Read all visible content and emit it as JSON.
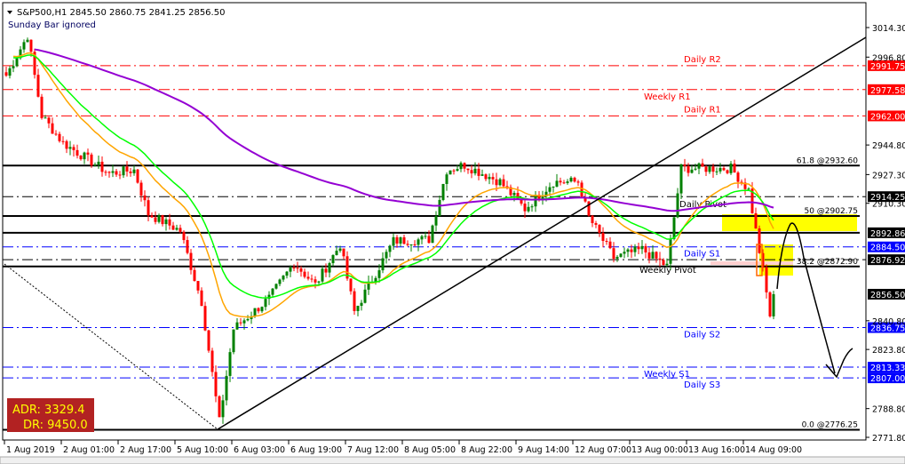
{
  "header": {
    "symbol_line": "S&P500,H1  2845.50 2860.75 2841.25 2856.50",
    "note": "Sunday Bar ignored"
  },
  "adr_box": {
    "adr": "ADR: 3329.4",
    "dr": "DR: 9450.0",
    "bg": "#b22222",
    "fg": "#ffff00"
  },
  "colors": {
    "bull": "#008000",
    "bear": "#ff0000",
    "ma_fast": "#ffa500",
    "ma_mid": "#00ff00",
    "ma_slow": "#9400d3",
    "ma_daily": "#006400"
  },
  "chart_data": {
    "type": "candlestick",
    "title": "S&P500,H1",
    "x_ticks": [
      "1 Aug 2019",
      "2 Aug 01:00",
      "2 Aug 17:00",
      "5 Aug 10:00",
      "6 Aug 03:00",
      "6 Aug 19:00",
      "7 Aug 12:00",
      "8 Aug 05:00",
      "8 Aug 22:00",
      "9 Aug 14:00",
      "12 Aug 07:00",
      "13 Aug 00:00",
      "13 Aug 16:00",
      "14 Aug 09:00"
    ],
    "bars_per_tick": 16,
    "y_ticks": [
      "3014.30",
      "2996.80",
      "2944.80",
      "2927.30",
      "2910.30",
      "2840.80",
      "2823.80",
      "2788.80",
      "2771.80"
    ],
    "ylim": [
      2771.8,
      3014.3
    ],
    "close_keyframes": [
      [
        0,
        2985.9
      ],
      [
        6,
        3009.6
      ],
      [
        10,
        2962
      ],
      [
        16,
        2946
      ],
      [
        29,
        2928
      ],
      [
        36,
        2930
      ],
      [
        40,
        2904
      ],
      [
        49,
        2894
      ],
      [
        55,
        2852
      ],
      [
        60,
        2781
      ],
      [
        64,
        2836
      ],
      [
        74,
        2854
      ],
      [
        81,
        2875
      ],
      [
        87,
        2862
      ],
      [
        94,
        2886
      ],
      [
        98,
        2846
      ],
      [
        109,
        2888
      ],
      [
        119,
        2889
      ],
      [
        124,
        2930
      ],
      [
        129,
        2933
      ],
      [
        139,
        2923
      ],
      [
        146,
        2907
      ],
      [
        154,
        2923
      ],
      [
        161,
        2923
      ],
      [
        164,
        2902
      ],
      [
        171,
        2878
      ],
      [
        179,
        2883
      ],
      [
        186,
        2873
      ],
      [
        190,
        2931
      ],
      [
        199,
        2931
      ],
      [
        204,
        2931
      ],
      [
        209,
        2918
      ],
      [
        211,
        2894
      ],
      [
        213,
        2870
      ],
      [
        215,
        2844
      ],
      [
        216,
        2856.5
      ]
    ],
    "levels": [
      {
        "label": "Daily R2",
        "price": 2991.75,
        "tag": "2991.75",
        "color": "#ff0000",
        "kind": "pivot",
        "tagbg": "#ff0000"
      },
      {
        "label": "Weekly R1",
        "price": 2977.58,
        "tag": "2977.58",
        "color": "#ff0000",
        "kind": "pivot",
        "tagbg": "#ff0000"
      },
      {
        "label": "Daily R1",
        "price": 2962.0,
        "tag": "2962.00",
        "color": "#ff0000",
        "kind": "pivot",
        "tagbg": "#ff0000"
      },
      {
        "label": "Daily Pivot",
        "price": 2914.25,
        "tag": "2914.25",
        "color": "#000000",
        "kind": "pivot",
        "tagbg": "#000000"
      },
      {
        "label": "Daily S1",
        "price": 2884.5,
        "tag": "2884.50",
        "color": "#0000ff",
        "kind": "pivot",
        "tagbg": "#0000ff"
      },
      {
        "label": "Weekly Pivot",
        "price": 2876.92,
        "tag": "2876.92",
        "color": "#000000",
        "kind": "pivot",
        "tagbg": "#000000"
      },
      {
        "label": "Daily S2",
        "price": 2836.75,
        "tag": "2836.75",
        "color": "#0000ff",
        "kind": "pivot",
        "tagbg": "#0000ff"
      },
      {
        "label": "Weekly S1",
        "price": 2813.33,
        "tag": "2813.33",
        "color": "#0000ff",
        "kind": "pivot",
        "tagbg": "#0000ff"
      },
      {
        "label": "Daily S3",
        "price": 2807.0,
        "tag": "2807.00",
        "color": "#0000ff",
        "kind": "pivot",
        "tagbg": "#0000ff"
      }
    ],
    "fib_levels": [
      {
        "label": "61.8 @2932.60",
        "price": 2932.6
      },
      {
        "label": "50 @2902.75",
        "price": 2902.75
      },
      {
        "label": "38.2 @2872.90",
        "price": 2872.9
      },
      {
        "label": "0.0 @2776.25",
        "price": 2776.25
      }
    ],
    "horizontal_line": {
      "price": 2892.86,
      "tag": "2892.86"
    },
    "current_price": {
      "price": 2856.5,
      "tag": "2856.50"
    }
  }
}
